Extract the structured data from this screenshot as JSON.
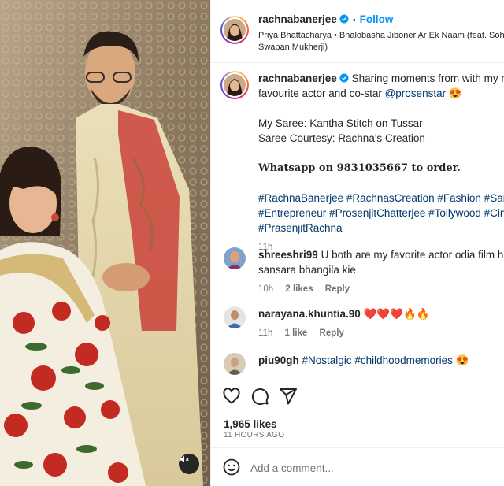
{
  "header": {
    "username": "rachnabanerjee",
    "separator": "•",
    "follow_label": "Follow",
    "audio_line1": "Priya Bhattacharya • Bhalobasha Jiboner Ar Ek Naam (feat. Sohail K",
    "audio_line2": "Swapan Mukherji)"
  },
  "caption": {
    "username": "rachnabanerjee",
    "line1_text": "Sharing moments from with my most",
    "line2_text": "favourite actor and co-star",
    "mention": "@prosenstar",
    "emoji": "😍",
    "saree_line": "My Saree: Kantha Stitch on Tussar",
    "courtesy_line": "Saree Courtesy: Rachna's Creation",
    "whatsapp_line": "Whatsapp on 9831035667 to order.",
    "hashtags_line1": "#RachnaBanerjee #RachnasCreation #Fashion #Saree #A",
    "hashtags_line2": "#Entrepreneur #ProsenjitChatterjee #Tollywood #Cinema",
    "hashtags_line3": "#PrasenjitRachna",
    "time": "11h"
  },
  "comments": [
    {
      "username": "shreeshri99",
      "text_line1": "U both are my favorite actor odia film hasila",
      "text_line2": "sansara bhangila kie",
      "time": "10h",
      "likes": "2 likes",
      "reply": "Reply"
    },
    {
      "username": "narayana.khuntia.90",
      "text": "❤️❤️❤️🔥🔥",
      "time": "11h",
      "likes": "1 like",
      "reply": "Reply"
    },
    {
      "username": "piu90gh",
      "text": "#Nostalgic #childhoodmemories",
      "emoji": "😍"
    }
  ],
  "actions": {
    "like_icon": "heart-outline-icon",
    "comment_icon": "speech-bubble-icon",
    "share_icon": "paper-plane-icon",
    "likes_count": "1,965 likes",
    "posted_ago": "11 HOURS AGO"
  },
  "add_comment": {
    "placeholder": "Add a comment...",
    "emoji_icon": "smiley-icon"
  },
  "media": {
    "mute_icon": "muted-speaker-icon"
  },
  "colors": {
    "link_blue": "#0095f6",
    "hashtag_blue": "#00376b",
    "muted_text": "#737373",
    "verified_blue": "#0095f6",
    "heart_red": "#ed1c24"
  }
}
